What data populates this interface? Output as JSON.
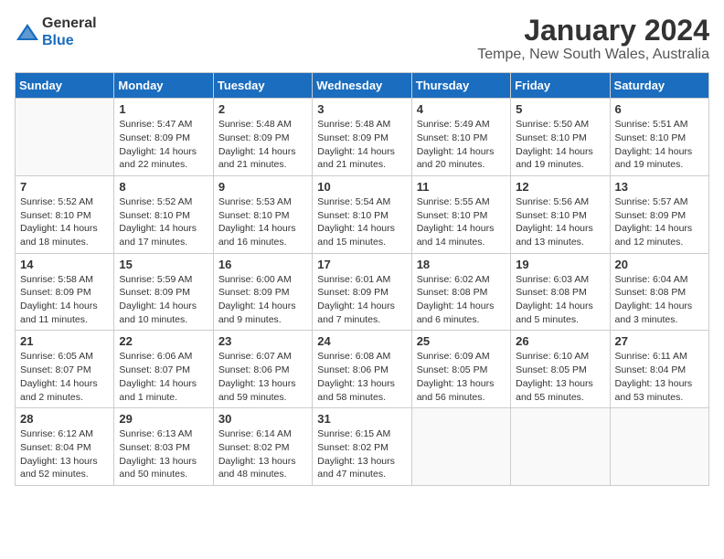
{
  "header": {
    "logo_line1": "General",
    "logo_line2": "Blue",
    "title": "January 2024",
    "subtitle": "Tempe, New South Wales, Australia"
  },
  "calendar": {
    "headers": [
      "Sunday",
      "Monday",
      "Tuesday",
      "Wednesday",
      "Thursday",
      "Friday",
      "Saturday"
    ],
    "weeks": [
      [
        {
          "day": "",
          "info": ""
        },
        {
          "day": "1",
          "info": "Sunrise: 5:47 AM\nSunset: 8:09 PM\nDaylight: 14 hours\nand 22 minutes."
        },
        {
          "day": "2",
          "info": "Sunrise: 5:48 AM\nSunset: 8:09 PM\nDaylight: 14 hours\nand 21 minutes."
        },
        {
          "day": "3",
          "info": "Sunrise: 5:48 AM\nSunset: 8:09 PM\nDaylight: 14 hours\nand 21 minutes."
        },
        {
          "day": "4",
          "info": "Sunrise: 5:49 AM\nSunset: 8:10 PM\nDaylight: 14 hours\nand 20 minutes."
        },
        {
          "day": "5",
          "info": "Sunrise: 5:50 AM\nSunset: 8:10 PM\nDaylight: 14 hours\nand 19 minutes."
        },
        {
          "day": "6",
          "info": "Sunrise: 5:51 AM\nSunset: 8:10 PM\nDaylight: 14 hours\nand 19 minutes."
        }
      ],
      [
        {
          "day": "7",
          "info": "Sunrise: 5:52 AM\nSunset: 8:10 PM\nDaylight: 14 hours\nand 18 minutes."
        },
        {
          "day": "8",
          "info": "Sunrise: 5:52 AM\nSunset: 8:10 PM\nDaylight: 14 hours\nand 17 minutes."
        },
        {
          "day": "9",
          "info": "Sunrise: 5:53 AM\nSunset: 8:10 PM\nDaylight: 14 hours\nand 16 minutes."
        },
        {
          "day": "10",
          "info": "Sunrise: 5:54 AM\nSunset: 8:10 PM\nDaylight: 14 hours\nand 15 minutes."
        },
        {
          "day": "11",
          "info": "Sunrise: 5:55 AM\nSunset: 8:10 PM\nDaylight: 14 hours\nand 14 minutes."
        },
        {
          "day": "12",
          "info": "Sunrise: 5:56 AM\nSunset: 8:10 PM\nDaylight: 14 hours\nand 13 minutes."
        },
        {
          "day": "13",
          "info": "Sunrise: 5:57 AM\nSunset: 8:09 PM\nDaylight: 14 hours\nand 12 minutes."
        }
      ],
      [
        {
          "day": "14",
          "info": "Sunrise: 5:58 AM\nSunset: 8:09 PM\nDaylight: 14 hours\nand 11 minutes."
        },
        {
          "day": "15",
          "info": "Sunrise: 5:59 AM\nSunset: 8:09 PM\nDaylight: 14 hours\nand 10 minutes."
        },
        {
          "day": "16",
          "info": "Sunrise: 6:00 AM\nSunset: 8:09 PM\nDaylight: 14 hours\nand 9 minutes."
        },
        {
          "day": "17",
          "info": "Sunrise: 6:01 AM\nSunset: 8:09 PM\nDaylight: 14 hours\nand 7 minutes."
        },
        {
          "day": "18",
          "info": "Sunrise: 6:02 AM\nSunset: 8:08 PM\nDaylight: 14 hours\nand 6 minutes."
        },
        {
          "day": "19",
          "info": "Sunrise: 6:03 AM\nSunset: 8:08 PM\nDaylight: 14 hours\nand 5 minutes."
        },
        {
          "day": "20",
          "info": "Sunrise: 6:04 AM\nSunset: 8:08 PM\nDaylight: 14 hours\nand 3 minutes."
        }
      ],
      [
        {
          "day": "21",
          "info": "Sunrise: 6:05 AM\nSunset: 8:07 PM\nDaylight: 14 hours\nand 2 minutes."
        },
        {
          "day": "22",
          "info": "Sunrise: 6:06 AM\nSunset: 8:07 PM\nDaylight: 14 hours\nand 1 minute."
        },
        {
          "day": "23",
          "info": "Sunrise: 6:07 AM\nSunset: 8:06 PM\nDaylight: 13 hours\nand 59 minutes."
        },
        {
          "day": "24",
          "info": "Sunrise: 6:08 AM\nSunset: 8:06 PM\nDaylight: 13 hours\nand 58 minutes."
        },
        {
          "day": "25",
          "info": "Sunrise: 6:09 AM\nSunset: 8:05 PM\nDaylight: 13 hours\nand 56 minutes."
        },
        {
          "day": "26",
          "info": "Sunrise: 6:10 AM\nSunset: 8:05 PM\nDaylight: 13 hours\nand 55 minutes."
        },
        {
          "day": "27",
          "info": "Sunrise: 6:11 AM\nSunset: 8:04 PM\nDaylight: 13 hours\nand 53 minutes."
        }
      ],
      [
        {
          "day": "28",
          "info": "Sunrise: 6:12 AM\nSunset: 8:04 PM\nDaylight: 13 hours\nand 52 minutes."
        },
        {
          "day": "29",
          "info": "Sunrise: 6:13 AM\nSunset: 8:03 PM\nDaylight: 13 hours\nand 50 minutes."
        },
        {
          "day": "30",
          "info": "Sunrise: 6:14 AM\nSunset: 8:02 PM\nDaylight: 13 hours\nand 48 minutes."
        },
        {
          "day": "31",
          "info": "Sunrise: 6:15 AM\nSunset: 8:02 PM\nDaylight: 13 hours\nand 47 minutes."
        },
        {
          "day": "",
          "info": ""
        },
        {
          "day": "",
          "info": ""
        },
        {
          "day": "",
          "info": ""
        }
      ]
    ]
  }
}
